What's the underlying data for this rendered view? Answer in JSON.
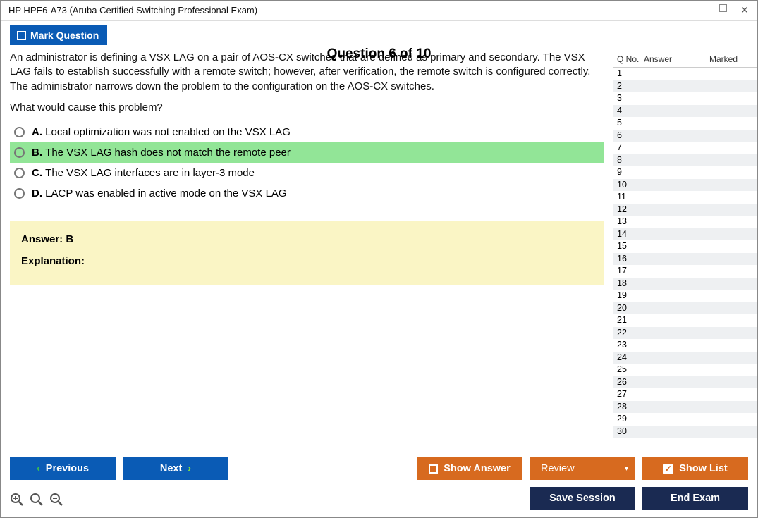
{
  "window": {
    "title": "HP HPE6-A73 (Aruba Certified Switching Professional Exam)"
  },
  "header": {
    "mark_label": "Mark Question",
    "counter": "Question 6 of 10"
  },
  "question": {
    "para1": "An administrator is defining a VSX LAG on a pair of AOS-CX switches that are defined as primary and secondary. The VSX LAG fails to establish successfully with a remote switch; however, after verification, the remote switch is configured correctly. The administrator narrows down the problem to the configuration on the AOS-CX switches.",
    "para2": "What would cause this problem?"
  },
  "options": [
    {
      "letter": "A.",
      "text": "Local optimization was not enabled on the VSX LAG",
      "highlight": false
    },
    {
      "letter": "B.",
      "text": "The VSX LAG hash does not match the remote peer",
      "highlight": true
    },
    {
      "letter": "C.",
      "text": "The VSX LAG interfaces are in layer-3 mode",
      "highlight": false
    },
    {
      "letter": "D.",
      "text": "LACP was enabled in active mode on the VSX LAG",
      "highlight": false
    }
  ],
  "answer_panel": {
    "answer": "Answer: B",
    "explanation_label": "Explanation:"
  },
  "sidepanel": {
    "h_qno": "Q No.",
    "h_answer": "Answer",
    "h_marked": "Marked",
    "rows": 30
  },
  "buttons": {
    "previous": "Previous",
    "next": "Next",
    "show_answer": "Show Answer",
    "review": "Review",
    "show_list": "Show List",
    "save_session": "Save Session",
    "end_exam": "End Exam"
  }
}
